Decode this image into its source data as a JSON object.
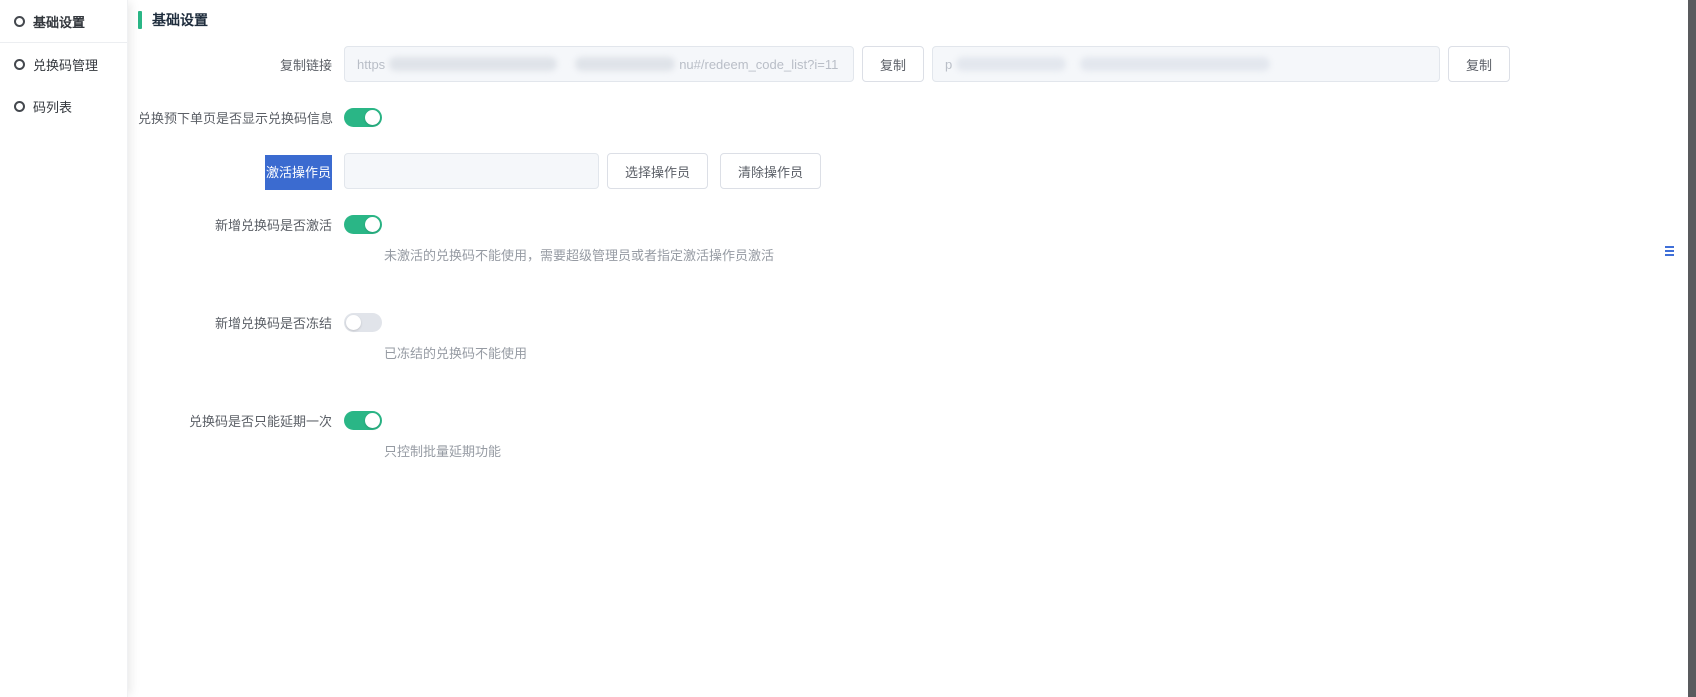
{
  "sidebar": {
    "items": [
      {
        "label": "基础设置",
        "icon": "circle-icon",
        "active": true
      },
      {
        "label": "兑换码管理",
        "icon": "circle-icon",
        "active": false
      },
      {
        "label": "码列表",
        "icon": "circle-icon",
        "active": false
      }
    ]
  },
  "main": {
    "section_title": "基础设置",
    "rows": {
      "copy_link": {
        "label": "复制链接",
        "input1": {
          "visible_prefix": "https",
          "visible_suffix": "nu#/redeem_code_list?i=11",
          "redacted_middle": true
        },
        "copy_button1": "复制",
        "input2": {
          "visible_prefix": "p",
          "redacted_middle": true
        },
        "copy_button2": "复制"
      },
      "show_code_info": {
        "label": "兑换预下单页是否显示兑换码信息",
        "state": "on"
      },
      "activation_operator": {
        "label": "激活操作员",
        "label_selected": true,
        "input_value": "",
        "select_button": "选择操作员",
        "clear_button": "清除操作员"
      },
      "new_code_activated": {
        "label": "新增兑换码是否激活",
        "state": "on",
        "hint": "未激活的兑换码不能使用，需要超级管理员或者指定激活操作员激活"
      },
      "new_code_frozen": {
        "label": "新增兑换码是否冻结",
        "state": "off",
        "hint": "已冻结的兑换码不能使用"
      },
      "extend_once": {
        "label": "兑换码是否只能延期一次",
        "state": "on",
        "hint": "只控制批量延期功能"
      }
    }
  },
  "colors": {
    "accent_green": "#2ab686",
    "toggle_off_gray": "#e1e4ea",
    "selection_blue": "#3b6bd0",
    "hint_gray": "#969ba3",
    "scrollbar_gray": "#595b5e"
  }
}
